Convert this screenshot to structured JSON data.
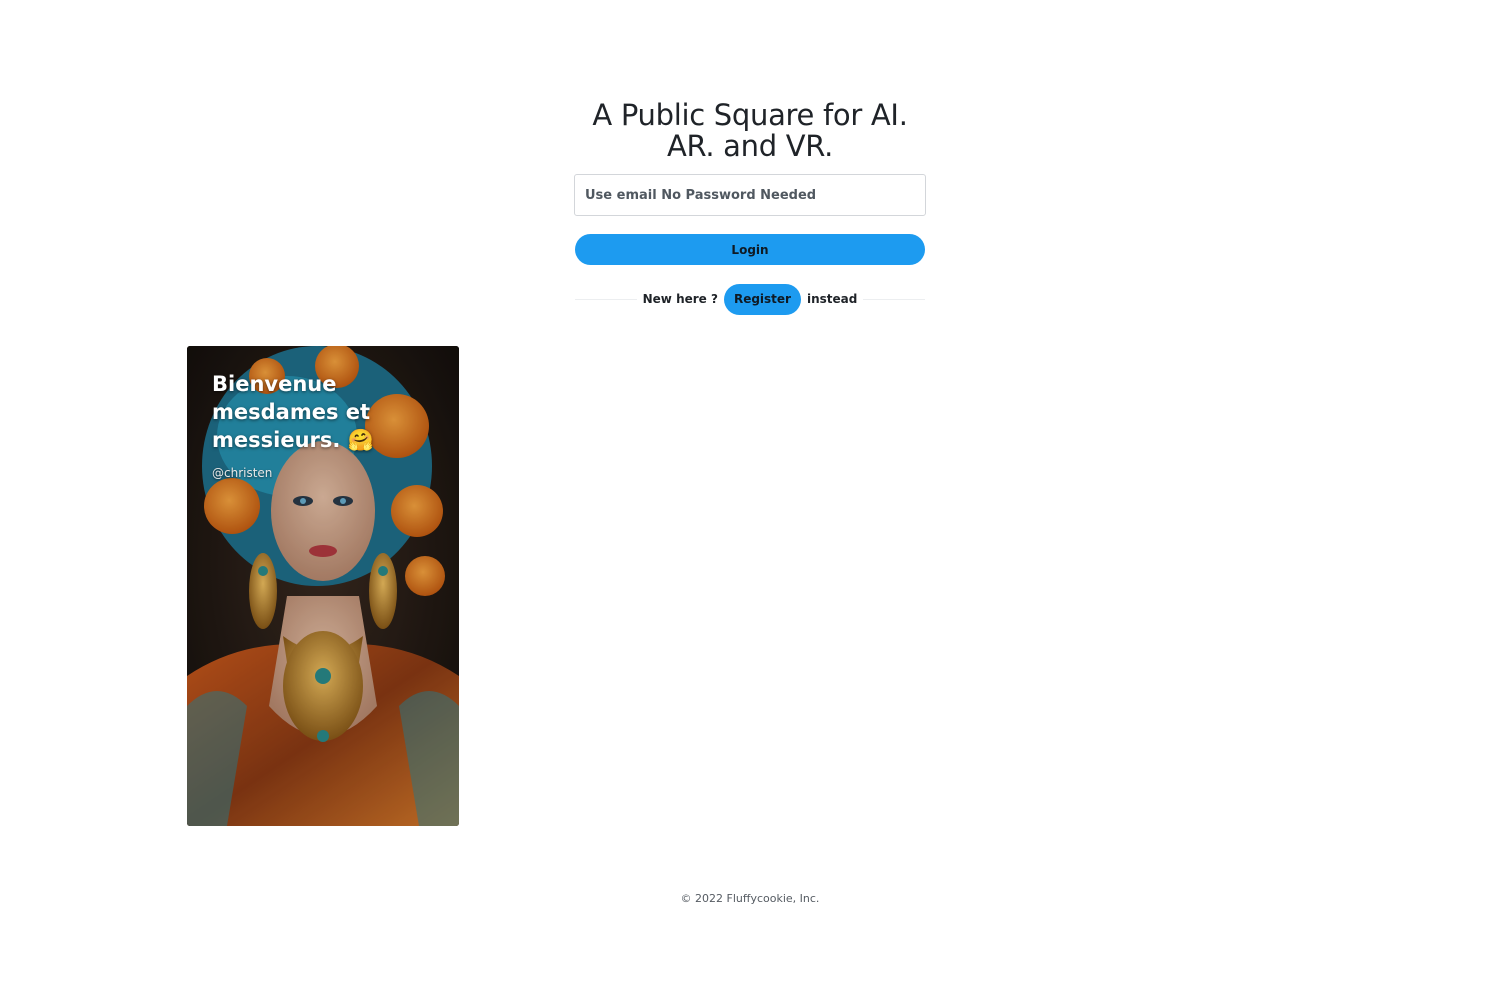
{
  "auth": {
    "headline": "A Public Square for AI. AR. and VR.",
    "email_placeholder": "Use email No Password Needed",
    "email_value": "",
    "login_label": "Login",
    "new_here_text": "New here ?",
    "register_label": "Register",
    "instead_text": "instead"
  },
  "post": {
    "title": "Bienvenue mesdames et messieurs. 🤗",
    "author": "@christen"
  },
  "footer": {
    "copyright": "© 2022 Fluffycookie, Inc."
  },
  "colors": {
    "accent": "#1d9bf0",
    "text": "#1f2328",
    "muted": "#555b62"
  }
}
